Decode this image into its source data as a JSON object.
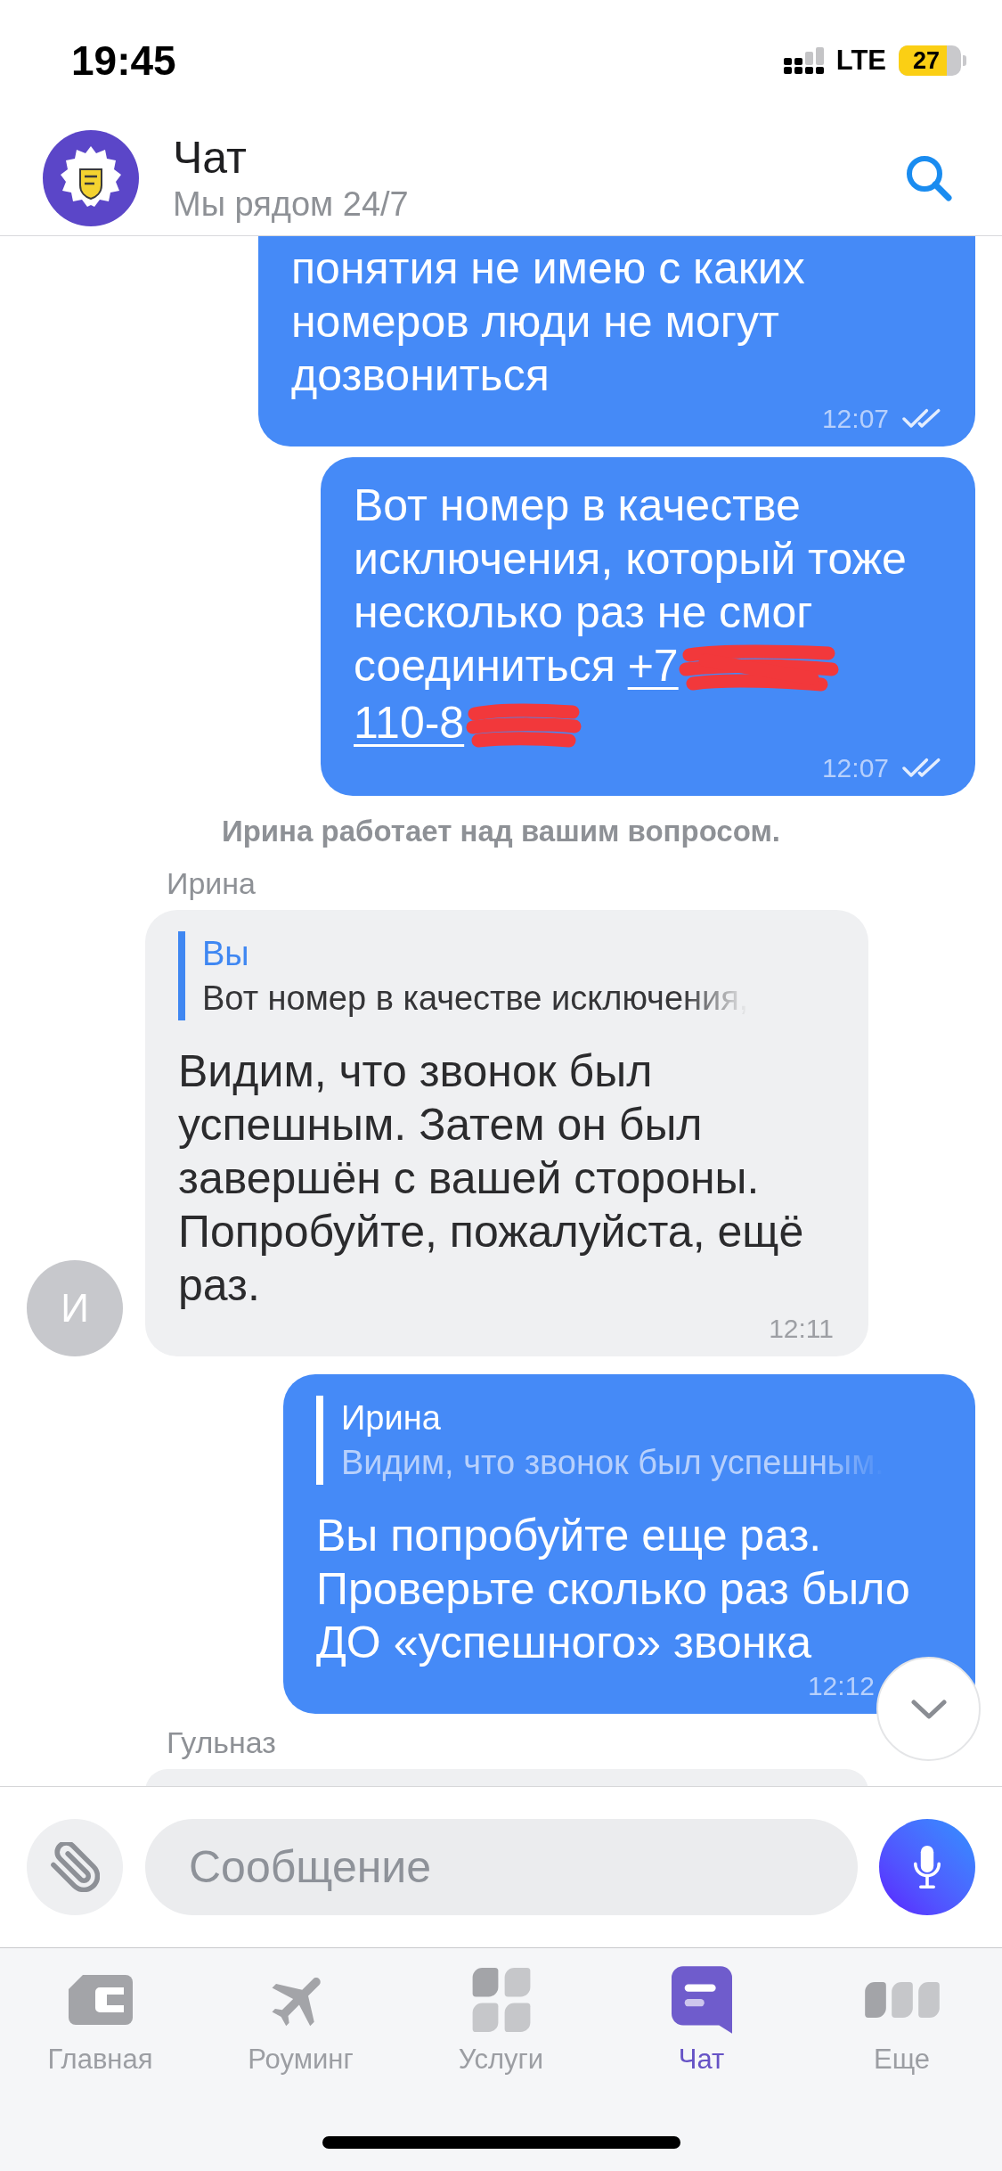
{
  "status_bar": {
    "time": "19:45",
    "network": "LTE",
    "battery": "27"
  },
  "header": {
    "title": "Чат",
    "subtitle": "Мы рядом 24/7"
  },
  "messages": [
    {
      "kind": "outgoing",
      "clipped_top": true,
      "text": "понятия не имею с каких номеров люди не могут дозвониться",
      "time": "12:07",
      "read": true
    },
    {
      "kind": "outgoing",
      "text": "Вот номер в качестве исключения, который тоже несколько раз не смог соединиться",
      "phone_parts": [
        "+7",
        "110-8"
      ],
      "redacted": true,
      "time": "12:07",
      "read": true
    },
    {
      "kind": "system",
      "text": "Ирина работает над вашим вопросом."
    },
    {
      "kind": "incoming",
      "sender": "Ирина",
      "avatar": "И",
      "reply": {
        "author": "Вы",
        "text": "Вот номер в качестве исключения,"
      },
      "text": "Видим, что звонок был успешным. Затем он был завершён с вашей стороны. Попробуйте, пожалуйста, ещё раз.",
      "time": "12:11"
    },
    {
      "kind": "outgoing",
      "reply": {
        "author": "Ирина",
        "text": "Видим, что звонок был успешным."
      },
      "text": "Вы попробуйте еще раз. Проверьте сколько раз было ДО «успешного» звонка",
      "time": "12:12"
    },
    {
      "kind": "incoming",
      "sender": "Гульназ"
    }
  ],
  "composer": {
    "placeholder": "Сообщение"
  },
  "tabs": [
    {
      "label": "Главная",
      "selected": false
    },
    {
      "label": "Роуминг",
      "selected": false
    },
    {
      "label": "Услуги",
      "selected": false
    },
    {
      "label": "Чат",
      "selected": true
    },
    {
      "label": "Еще",
      "selected": false
    }
  ]
}
